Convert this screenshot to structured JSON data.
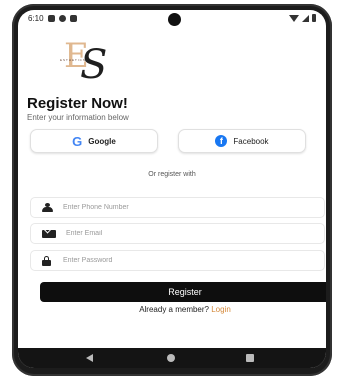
{
  "statusbar": {
    "time": "6:10"
  },
  "logo": {
    "letter_e": "E",
    "letter_s": "S",
    "small_text": "ESTHETICS"
  },
  "header": {
    "title": "Register Now!",
    "subtitle": "Enter your information below"
  },
  "social": {
    "google_label": "Google",
    "google_icon": "G",
    "facebook_label": "Facebook",
    "facebook_icon": "f"
  },
  "divider_text": "Or register with",
  "form": {
    "phone_placeholder": "Enter Phone Number",
    "email_placeholder": "Enter Email",
    "password_placeholder": "Enter Password",
    "register_label": "Register"
  },
  "footer": {
    "member_text": "Already a member?",
    "login_label": "Login"
  },
  "colors": {
    "accent": "#d4893b",
    "primary_button": "#0e0e0e",
    "facebook_blue": "#1877F2"
  }
}
